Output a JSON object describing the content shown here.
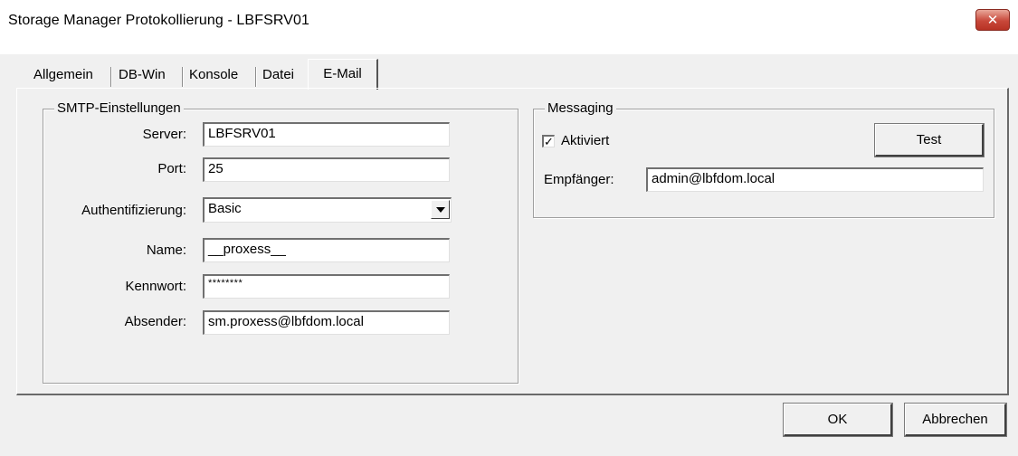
{
  "window": {
    "title": "Storage Manager Protokollierung - LBFSRV01",
    "close_glyph": "✕"
  },
  "tabs": [
    {
      "label": "Allgemein",
      "active": false
    },
    {
      "label": "DB-Win",
      "active": false
    },
    {
      "label": "Konsole",
      "active": false
    },
    {
      "label": "Datei",
      "active": false
    },
    {
      "label": "E-Mail",
      "active": true
    }
  ],
  "smtp": {
    "legend": "SMTP-Einstellungen",
    "server_label": "Server:",
    "server_value": "LBFSRV01",
    "port_label": "Port:",
    "port_value": "25",
    "auth_label": "Authentifizierung:",
    "auth_value": "Basic",
    "name_label": "Name:",
    "name_value": "__proxess__",
    "password_label": "Kennwort:",
    "password_value": "********",
    "sender_label": "Absender:",
    "sender_value": "sm.proxess@lbfdom.local"
  },
  "messaging": {
    "legend": "Messaging",
    "activated_label": "Aktiviert",
    "activated_checked": true,
    "check_glyph": "✓",
    "test_button": "Test",
    "recipient_label": "Empfänger:",
    "recipient_value": "admin@lbfdom.local"
  },
  "footer": {
    "ok_button": "OK",
    "cancel_button": "Abbrechen"
  },
  "colors": {
    "dialog_bg": "#f0f0f0",
    "close_button_red": "#c8483a"
  }
}
